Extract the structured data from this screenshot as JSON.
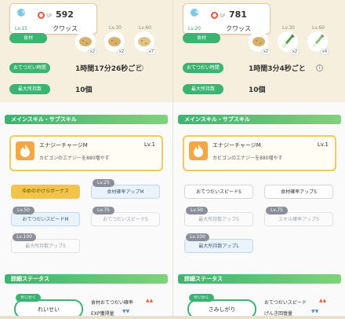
{
  "common": {
    "sp_label": "SP",
    "lv_label": "Lv.",
    "ingredients_pill": "食材",
    "help_interval_label": "おてつだい時間",
    "max_carry_label": "最大所持数",
    "help_glyph": "i",
    "main_sub_skill_title": "メインスキル・サブスキル",
    "skill_name": "エナジーチャージM",
    "skill_desc": "カビゴンのエナジーを880増やす",
    "detail_title": "詳細ステータス",
    "nature_label": "せいかく",
    "colors": {
      "accent": "#3cb371",
      "gold": "#f2c44c",
      "strength_red": "#e4533b"
    }
  },
  "left": {
    "sp": "592",
    "poke_lv": "Lv.15",
    "name": "クワッス",
    "skill_level": "Lv.1",
    "ingredients": [
      {
        "lv": "",
        "count": "x2",
        "icon": "potato-icon"
      },
      {
        "lv": "Lv.30",
        "count": "x2",
        "icon": "potato-icon"
      },
      {
        "lv": "Lv.60",
        "count": "x7",
        "icon": "potato-icon"
      }
    ],
    "help_interval": "1時間17分26秒ごと",
    "max_carry": "10個",
    "sub_skills": [
      {
        "lock": "",
        "label": "ゆめのかけらボーナス",
        "style": "gold"
      },
      {
        "lock": "Lv.25",
        "label": "食材確率アップM",
        "style": "blue"
      },
      {
        "lock": "Lv.50",
        "label": "おてつだいスピードM",
        "style": "blue"
      },
      {
        "lock": "Lv.75",
        "label": "おてつだいスピードS",
        "style": "dim"
      },
      {
        "lock": "Lv.100",
        "label": "最大所持数アップS",
        "style": "dim"
      }
    ],
    "nature": "れいせい",
    "detail_up": "食材おてつだい確率",
    "detail_down": "EXP獲得量"
  },
  "right": {
    "sp": "781",
    "poke_lv": "Lv.20",
    "name": "クワッス",
    "skill_level": "Lv.1",
    "ingredients": [
      {
        "lv": "",
        "count": "x2",
        "icon": "potato-icon"
      },
      {
        "lv": "Lv.30",
        "count": "x2",
        "icon": "leek-icon"
      },
      {
        "lv": "Lv.60",
        "count": "x4",
        "icon": "leek-icon"
      }
    ],
    "help_interval": "1時間3分4秒ごと",
    "max_carry": "10個",
    "sub_skills": [
      {
        "lock": "",
        "label": "おてつだいスピードS",
        "style": "gray"
      },
      {
        "lock": "",
        "label": "食材確率アップS",
        "style": "gray"
      },
      {
        "lock": "Lv.50",
        "label": "最大所持数アップS",
        "style": "dim"
      },
      {
        "lock": "Lv.75",
        "label": "スキル確率アップS",
        "style": "dim"
      },
      {
        "lock": "Lv.100",
        "label": "最大所持数アップL",
        "style": "blue"
      }
    ],
    "nature": "さみしがり",
    "detail_up": "おてつだいスピード",
    "detail_down": "げんき回復量"
  }
}
